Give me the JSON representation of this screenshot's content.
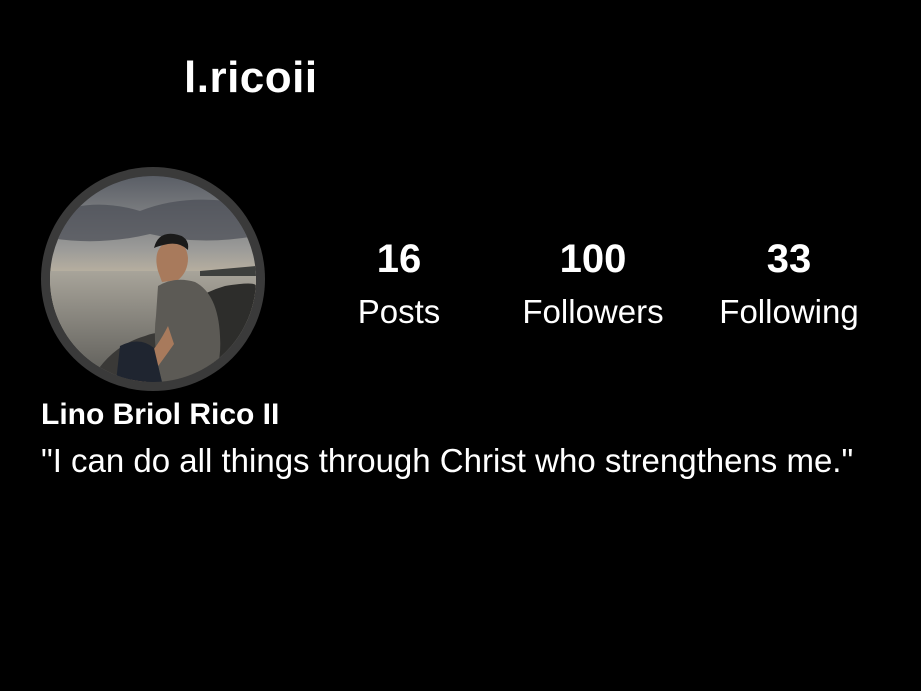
{
  "profile": {
    "username": "l.ricoii",
    "full_name": "Lino Briol Rico II",
    "bio": "\"I can do all things through Christ who strengthens me.\"",
    "avatar_icon": "profile-photo"
  },
  "stats": {
    "posts": {
      "count": "16",
      "label": "Posts"
    },
    "followers": {
      "count": "100",
      "label": "Followers"
    },
    "following": {
      "count": "33",
      "label": "Following"
    }
  },
  "colors": {
    "background": "#000000",
    "text": "#ffffff",
    "avatar_ring": "#3a3a3a"
  }
}
